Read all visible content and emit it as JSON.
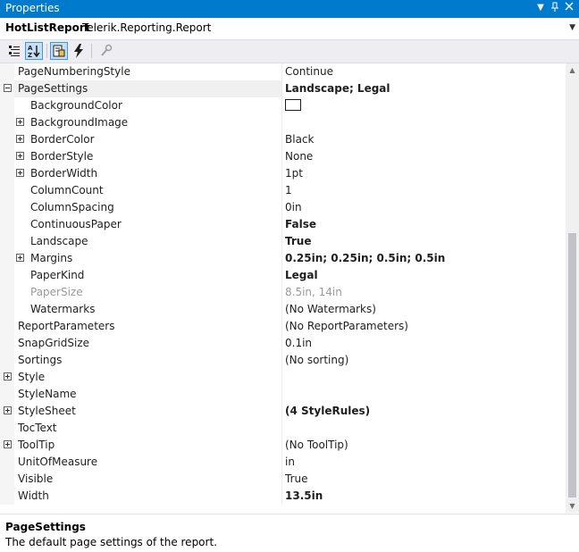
{
  "window": {
    "title": "Properties"
  },
  "object": {
    "name": "HotListReport",
    "type": "Telerik.Reporting.Report"
  },
  "properties": [
    {
      "name": "PageNumberingStyle",
      "value": "Continue",
      "level": 0,
      "expander": "none",
      "bold": false,
      "disabled": false,
      "selected": false
    },
    {
      "name": "PageSettings",
      "value": "Landscape; Legal",
      "level": 0,
      "expander": "minus",
      "bold": true,
      "disabled": false,
      "selected": true
    },
    {
      "name": "BackgroundColor",
      "value": "",
      "level": 1,
      "expander": "none",
      "bold": false,
      "disabled": false,
      "selected": false,
      "swatch": "#ffffff"
    },
    {
      "name": "BackgroundImage",
      "value": "",
      "level": 1,
      "expander": "plus",
      "bold": false,
      "disabled": false,
      "selected": false
    },
    {
      "name": "BorderColor",
      "value": "Black",
      "level": 1,
      "expander": "plus",
      "bold": false,
      "disabled": false,
      "selected": false
    },
    {
      "name": "BorderStyle",
      "value": "None",
      "level": 1,
      "expander": "plus",
      "bold": false,
      "disabled": false,
      "selected": false
    },
    {
      "name": "BorderWidth",
      "value": "1pt",
      "level": 1,
      "expander": "plus",
      "bold": false,
      "disabled": false,
      "selected": false
    },
    {
      "name": "ColumnCount",
      "value": "1",
      "level": 1,
      "expander": "none",
      "bold": false,
      "disabled": false,
      "selected": false
    },
    {
      "name": "ColumnSpacing",
      "value": "0in",
      "level": 1,
      "expander": "none",
      "bold": false,
      "disabled": false,
      "selected": false
    },
    {
      "name": "ContinuousPaper",
      "value": "False",
      "level": 1,
      "expander": "none",
      "bold": true,
      "disabled": false,
      "selected": false
    },
    {
      "name": "Landscape",
      "value": "True",
      "level": 1,
      "expander": "none",
      "bold": true,
      "disabled": false,
      "selected": false
    },
    {
      "name": "Margins",
      "value": "0.25in; 0.25in; 0.5in; 0.5in",
      "level": 1,
      "expander": "plus",
      "bold": true,
      "disabled": false,
      "selected": false
    },
    {
      "name": "PaperKind",
      "value": "Legal",
      "level": 1,
      "expander": "none",
      "bold": true,
      "disabled": false,
      "selected": false
    },
    {
      "name": "PaperSize",
      "value": "8.5in, 14in",
      "level": 1,
      "expander": "none",
      "bold": false,
      "disabled": true,
      "selected": false
    },
    {
      "name": "Watermarks",
      "value": "(No Watermarks)",
      "level": 1,
      "expander": "none",
      "bold": false,
      "disabled": false,
      "selected": false
    },
    {
      "name": "ReportParameters",
      "value": "(No ReportParameters)",
      "level": 0,
      "expander": "none",
      "bold": false,
      "disabled": false,
      "selected": false
    },
    {
      "name": "SnapGridSize",
      "value": "0.1in",
      "level": 0,
      "expander": "none",
      "bold": false,
      "disabled": false,
      "selected": false
    },
    {
      "name": "Sortings",
      "value": "(No sorting)",
      "level": 0,
      "expander": "none",
      "bold": false,
      "disabled": false,
      "selected": false
    },
    {
      "name": "Style",
      "value": "",
      "level": 0,
      "expander": "plus",
      "bold": false,
      "disabled": false,
      "selected": false
    },
    {
      "name": "StyleName",
      "value": "",
      "level": 0,
      "expander": "none",
      "bold": false,
      "disabled": false,
      "selected": false
    },
    {
      "name": "StyleSheet",
      "value": "(4 StyleRules)",
      "level": 0,
      "expander": "plus",
      "bold": true,
      "disabled": false,
      "selected": false
    },
    {
      "name": "TocText",
      "value": "",
      "level": 0,
      "expander": "none",
      "bold": false,
      "disabled": false,
      "selected": false
    },
    {
      "name": "ToolTip",
      "value": "(No ToolTip)",
      "level": 0,
      "expander": "plus",
      "bold": false,
      "disabled": false,
      "selected": false
    },
    {
      "name": "UnitOfMeasure",
      "value": "in",
      "level": 0,
      "expander": "none",
      "bold": false,
      "disabled": false,
      "selected": false
    },
    {
      "name": "Visible",
      "value": "True",
      "level": 0,
      "expander": "none",
      "bold": false,
      "disabled": false,
      "selected": false
    },
    {
      "name": "Width",
      "value": "13.5in",
      "level": 0,
      "expander": "none",
      "bold": true,
      "disabled": false,
      "selected": false
    }
  ],
  "description": {
    "title": "PageSettings",
    "text": "The default page settings of the report."
  },
  "colors": {
    "titlebar": "#007acc",
    "toolbar": "#eeeef2",
    "active_button": "#c9def5",
    "disabled_text": "#9a9a9a"
  }
}
